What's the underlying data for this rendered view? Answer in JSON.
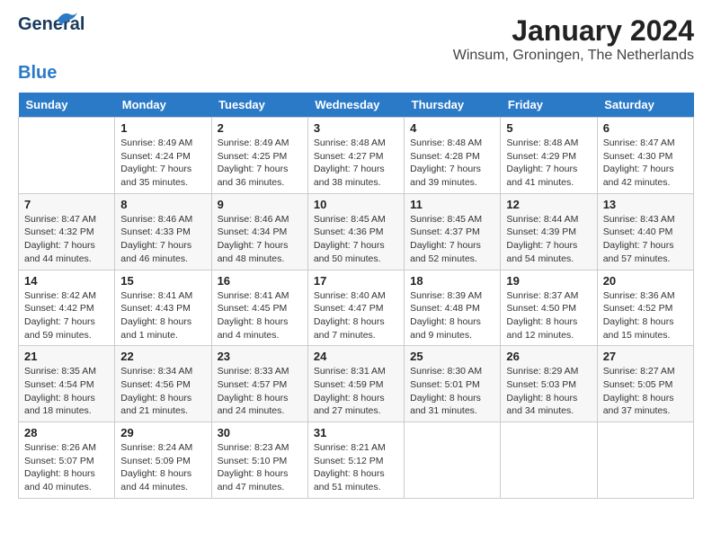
{
  "header": {
    "logo_line1": "General",
    "logo_line2": "Blue",
    "month": "January 2024",
    "location": "Winsum, Groningen, The Netherlands"
  },
  "days_of_week": [
    "Sunday",
    "Monday",
    "Tuesday",
    "Wednesday",
    "Thursday",
    "Friday",
    "Saturday"
  ],
  "weeks": [
    [
      {
        "date": "",
        "info": ""
      },
      {
        "date": "1",
        "info": "Sunrise: 8:49 AM\nSunset: 4:24 PM\nDaylight: 7 hours\nand 35 minutes."
      },
      {
        "date": "2",
        "info": "Sunrise: 8:49 AM\nSunset: 4:25 PM\nDaylight: 7 hours\nand 36 minutes."
      },
      {
        "date": "3",
        "info": "Sunrise: 8:48 AM\nSunset: 4:27 PM\nDaylight: 7 hours\nand 38 minutes."
      },
      {
        "date": "4",
        "info": "Sunrise: 8:48 AM\nSunset: 4:28 PM\nDaylight: 7 hours\nand 39 minutes."
      },
      {
        "date": "5",
        "info": "Sunrise: 8:48 AM\nSunset: 4:29 PM\nDaylight: 7 hours\nand 41 minutes."
      },
      {
        "date": "6",
        "info": "Sunrise: 8:47 AM\nSunset: 4:30 PM\nDaylight: 7 hours\nand 42 minutes."
      }
    ],
    [
      {
        "date": "7",
        "info": "Sunrise: 8:47 AM\nSunset: 4:32 PM\nDaylight: 7 hours\nand 44 minutes."
      },
      {
        "date": "8",
        "info": "Sunrise: 8:46 AM\nSunset: 4:33 PM\nDaylight: 7 hours\nand 46 minutes."
      },
      {
        "date": "9",
        "info": "Sunrise: 8:46 AM\nSunset: 4:34 PM\nDaylight: 7 hours\nand 48 minutes."
      },
      {
        "date": "10",
        "info": "Sunrise: 8:45 AM\nSunset: 4:36 PM\nDaylight: 7 hours\nand 50 minutes."
      },
      {
        "date": "11",
        "info": "Sunrise: 8:45 AM\nSunset: 4:37 PM\nDaylight: 7 hours\nand 52 minutes."
      },
      {
        "date": "12",
        "info": "Sunrise: 8:44 AM\nSunset: 4:39 PM\nDaylight: 7 hours\nand 54 minutes."
      },
      {
        "date": "13",
        "info": "Sunrise: 8:43 AM\nSunset: 4:40 PM\nDaylight: 7 hours\nand 57 minutes."
      }
    ],
    [
      {
        "date": "14",
        "info": "Sunrise: 8:42 AM\nSunset: 4:42 PM\nDaylight: 7 hours\nand 59 minutes."
      },
      {
        "date": "15",
        "info": "Sunrise: 8:41 AM\nSunset: 4:43 PM\nDaylight: 8 hours\nand 1 minute."
      },
      {
        "date": "16",
        "info": "Sunrise: 8:41 AM\nSunset: 4:45 PM\nDaylight: 8 hours\nand 4 minutes."
      },
      {
        "date": "17",
        "info": "Sunrise: 8:40 AM\nSunset: 4:47 PM\nDaylight: 8 hours\nand 7 minutes."
      },
      {
        "date": "18",
        "info": "Sunrise: 8:39 AM\nSunset: 4:48 PM\nDaylight: 8 hours\nand 9 minutes."
      },
      {
        "date": "19",
        "info": "Sunrise: 8:37 AM\nSunset: 4:50 PM\nDaylight: 8 hours\nand 12 minutes."
      },
      {
        "date": "20",
        "info": "Sunrise: 8:36 AM\nSunset: 4:52 PM\nDaylight: 8 hours\nand 15 minutes."
      }
    ],
    [
      {
        "date": "21",
        "info": "Sunrise: 8:35 AM\nSunset: 4:54 PM\nDaylight: 8 hours\nand 18 minutes."
      },
      {
        "date": "22",
        "info": "Sunrise: 8:34 AM\nSunset: 4:56 PM\nDaylight: 8 hours\nand 21 minutes."
      },
      {
        "date": "23",
        "info": "Sunrise: 8:33 AM\nSunset: 4:57 PM\nDaylight: 8 hours\nand 24 minutes."
      },
      {
        "date": "24",
        "info": "Sunrise: 8:31 AM\nSunset: 4:59 PM\nDaylight: 8 hours\nand 27 minutes."
      },
      {
        "date": "25",
        "info": "Sunrise: 8:30 AM\nSunset: 5:01 PM\nDaylight: 8 hours\nand 31 minutes."
      },
      {
        "date": "26",
        "info": "Sunrise: 8:29 AM\nSunset: 5:03 PM\nDaylight: 8 hours\nand 34 minutes."
      },
      {
        "date": "27",
        "info": "Sunrise: 8:27 AM\nSunset: 5:05 PM\nDaylight: 8 hours\nand 37 minutes."
      }
    ],
    [
      {
        "date": "28",
        "info": "Sunrise: 8:26 AM\nSunset: 5:07 PM\nDaylight: 8 hours\nand 40 minutes."
      },
      {
        "date": "29",
        "info": "Sunrise: 8:24 AM\nSunset: 5:09 PM\nDaylight: 8 hours\nand 44 minutes."
      },
      {
        "date": "30",
        "info": "Sunrise: 8:23 AM\nSunset: 5:10 PM\nDaylight: 8 hours\nand 47 minutes."
      },
      {
        "date": "31",
        "info": "Sunrise: 8:21 AM\nSunset: 5:12 PM\nDaylight: 8 hours\nand 51 minutes."
      },
      {
        "date": "",
        "info": ""
      },
      {
        "date": "",
        "info": ""
      },
      {
        "date": "",
        "info": ""
      }
    ]
  ]
}
